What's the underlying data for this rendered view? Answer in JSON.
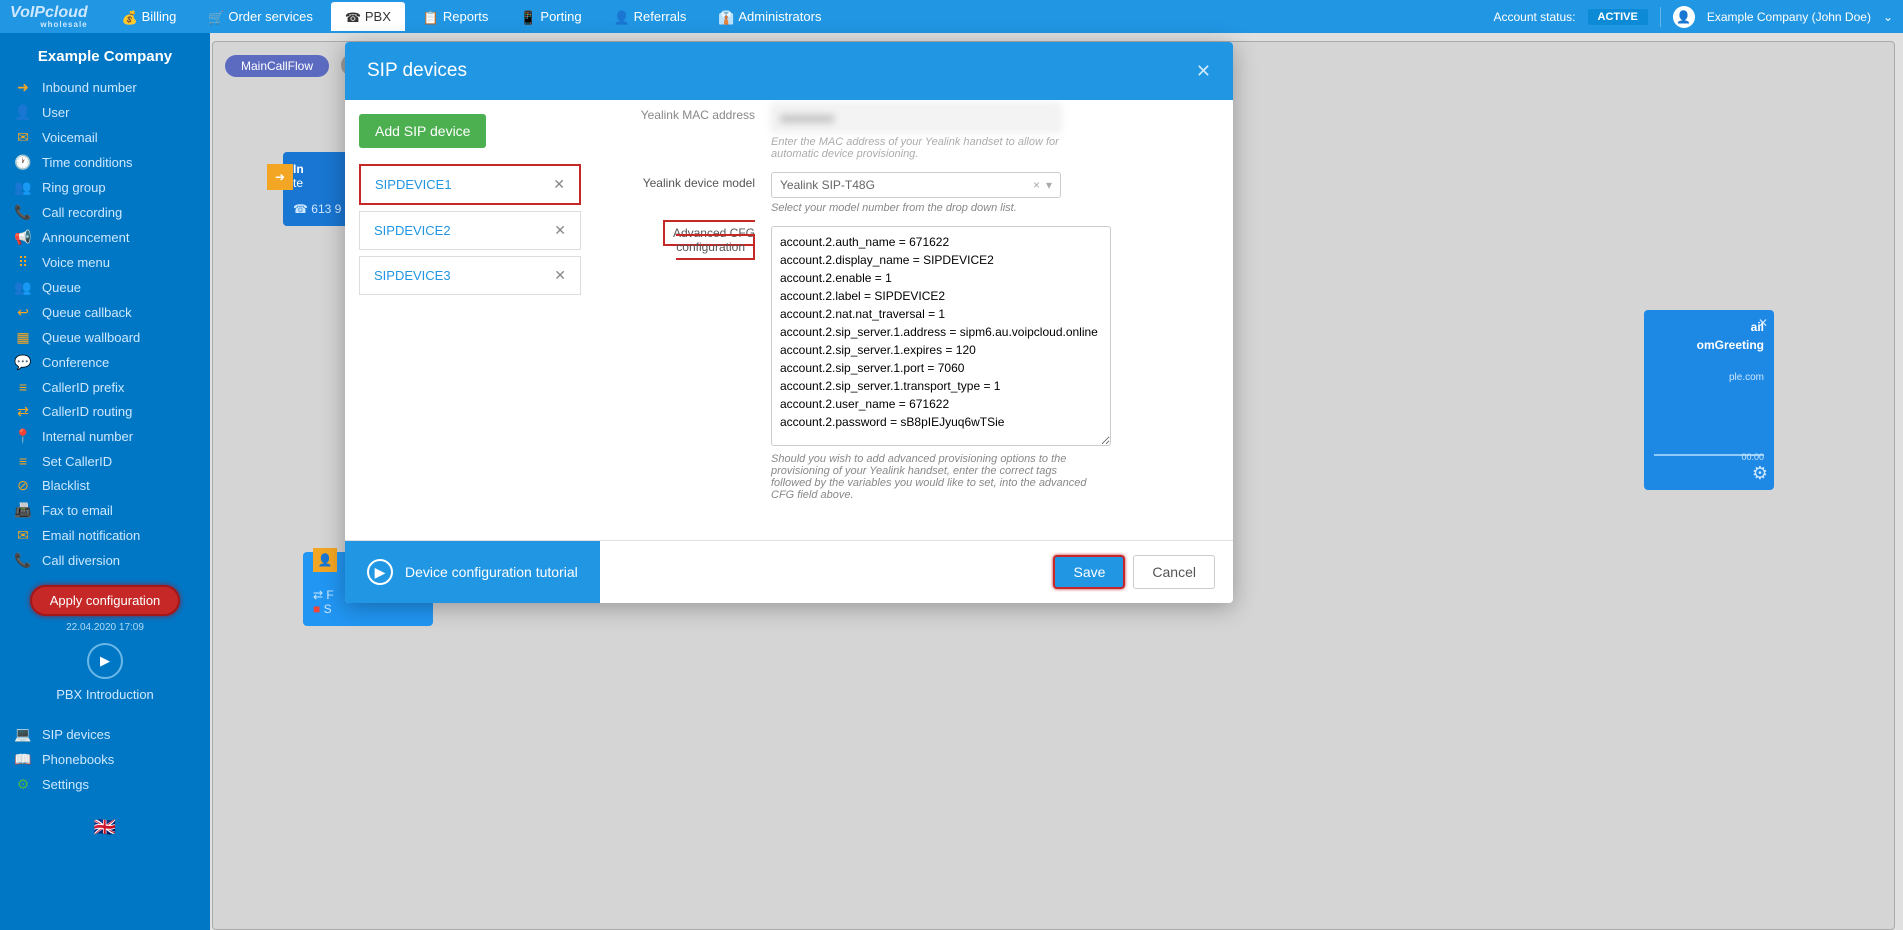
{
  "header": {
    "logo_top": "VoIPcloud",
    "logo_sub": "wholesale",
    "tabs": [
      {
        "label": "Billing",
        "icon": "💰"
      },
      {
        "label": "Order services",
        "icon": "🛒"
      },
      {
        "label": "PBX",
        "icon": "☎"
      },
      {
        "label": "Reports",
        "icon": "📋"
      },
      {
        "label": "Porting",
        "icon": "📱"
      },
      {
        "label": "Referrals",
        "icon": "👤"
      },
      {
        "label": "Administrators",
        "icon": "👔"
      }
    ],
    "account_status_label": "Account status:",
    "account_status": "ACTIVE",
    "user_display": "Example Company (John Doe)"
  },
  "sidebar": {
    "title": "Example Company",
    "items": [
      {
        "label": "Inbound number",
        "icon": "➜"
      },
      {
        "label": "User",
        "icon": "👤"
      },
      {
        "label": "Voicemail",
        "icon": "✉"
      },
      {
        "label": "Time conditions",
        "icon": "🕐"
      },
      {
        "label": "Ring group",
        "icon": "👥"
      },
      {
        "label": "Call recording",
        "icon": "📞"
      },
      {
        "label": "Announcement",
        "icon": "📢"
      },
      {
        "label": "Voice menu",
        "icon": "⠿"
      },
      {
        "label": "Queue",
        "icon": "👥+"
      },
      {
        "label": "Queue callback",
        "icon": "↩"
      },
      {
        "label": "Queue wallboard",
        "icon": "▦"
      },
      {
        "label": "Conference",
        "icon": "💬"
      },
      {
        "label": "CallerID prefix",
        "icon": "≡"
      },
      {
        "label": "CallerID routing",
        "icon": "⇄"
      },
      {
        "label": "Internal number",
        "icon": "📍"
      },
      {
        "label": "Set CallerID",
        "icon": "≡"
      },
      {
        "label": "Blacklist",
        "icon": "⊘"
      },
      {
        "label": "Fax to email",
        "icon": "📠"
      },
      {
        "label": "Email notification",
        "icon": "✉"
      },
      {
        "label": "Call diversion",
        "icon": "📞"
      }
    ],
    "apply_label": "Apply configuration",
    "timestamp": "22.04.2020 17:09",
    "intro": "PBX Introduction",
    "bottom": [
      {
        "label": "SIP devices",
        "icon": "💻"
      },
      {
        "label": "Phonebooks",
        "icon": "📖"
      },
      {
        "label": "Settings",
        "icon": "⚙"
      }
    ]
  },
  "canvas": {
    "flow_tab": "MainCallFlow",
    "inbound": {
      "prefix": "In",
      "line2": "te",
      "phone": "613 9"
    },
    "voicemail": {
      "title": "ail",
      "sub": "omGreeting",
      "domain": "ple.com",
      "time": "00:00"
    }
  },
  "modal": {
    "title": "SIP devices",
    "add_label": "Add SIP device",
    "devices": [
      "SIPDEVICE1",
      "SIPDEVICE2",
      "SIPDEVICE3"
    ],
    "mac_label": "Yealink MAC address",
    "mac_help": "Enter the MAC address of your Yealink handset to allow for automatic device provisioning.",
    "model_label": "Yealink device model",
    "model_value": "Yealink SIP-T48G",
    "model_help": "Select your model number from the drop down list.",
    "cfg_label": "Advanced CFG configuration",
    "cfg_lines": [
      "account.2.auth_name = 671622",
      "account.2.display_name = SIPDEVICE2",
      "account.2.enable = 1",
      "account.2.label = SIPDEVICE2",
      "account.2.nat.nat_traversal = 1",
      "account.2.sip_server.1.address = sipm6.au.voipcloud.online",
      "account.2.sip_server.1.expires = 120",
      "account.2.sip_server.1.port = 7060",
      "account.2.sip_server.1.transport_type = 1",
      "account.2.user_name = 671622",
      "account.2.password = sB8pIEJyuq6wTSie"
    ],
    "cfg_help": "Should you wish to add advanced provisioning options to the provisioning of your Yealink handset, enter the correct tags followed by the variables you would like to set, into the advanced CFG field above.",
    "tutorial": "Device configuration tutorial",
    "save": "Save",
    "cancel": "Cancel"
  }
}
